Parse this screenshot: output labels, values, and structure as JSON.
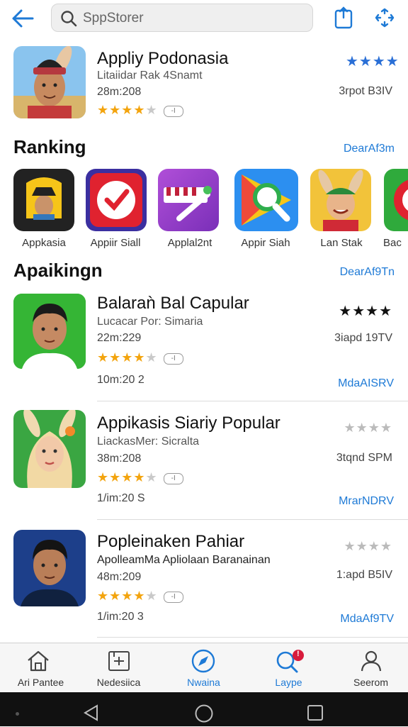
{
  "search": {
    "placeholder": "SppStorer"
  },
  "featured": {
    "title": "Appliy Podonasia",
    "subtitle": "Litaiidar Rak 4Snamt",
    "meta": "28m:208",
    "right_meta": "3rpot B3IV",
    "stars": 4.5,
    "chip": "-I",
    "star_color": "#2a6fd6"
  },
  "ranking": {
    "title": "Ranking",
    "link": "DearAf3m",
    "items": [
      {
        "label": "Appkasia",
        "icon": "portrait-hat-icon",
        "bg": "#222222"
      },
      {
        "label": "Appiir Siall",
        "icon": "red-heart-check-icon",
        "bg": "#d91c2a"
      },
      {
        "label": "Applal2nt",
        "icon": "piano-keyboard-icon",
        "bg": "#8a3fc8"
      },
      {
        "label": "Appir Siah",
        "icon": "play-search-icon",
        "bg": "#2c8ff0"
      },
      {
        "label": "Lan Stak",
        "icon": "bunny-character-icon",
        "bg": "#f2c33a"
      },
      {
        "label": "Bac",
        "icon": "red-circle-icon",
        "bg": "#2faa3c"
      }
    ]
  },
  "apps": {
    "title": "Apaikingn",
    "link": "DearAf9Tn",
    "items": [
      {
        "title": "Balaraǹ Bal Capular",
        "subtitle": "Lucacar Por: Simaria",
        "meta": "22m:229",
        "size": "10m:20 2",
        "right_meta": "3iapd 19TV",
        "link": "MdaAISRV",
        "stars": 4,
        "top_stars": "★★★★",
        "top_stars_color": "#111111",
        "chip": "-I",
        "thumb_bg": "#2fa32f"
      },
      {
        "title": "Appikasis Siariy Popular",
        "subtitle": "LiackasMer: Sicralta",
        "meta": "38m:208",
        "size": "1/im:20 S",
        "right_meta": "3tqnd SPM",
        "link": "MrarNDRV",
        "stars": 4,
        "top_stars": "★★★★",
        "top_stars_color": "#bbbbbb",
        "chip": "-I",
        "thumb_bg": "#2e9e3a"
      },
      {
        "title": "Popleinaken Pahiar",
        "subtitle": "ApolleamMa Apliolaan  Baranainan",
        "meta": "48m:209",
        "size": "1/im:20 3",
        "right_meta": "1:apd B5IV",
        "link": "MdaAf9TV",
        "stars": 4.5,
        "top_stars": "★★★★",
        "top_stars_color": "#bbbbbb",
        "chip": "-I",
        "thumb_bg": "#1d3f8a"
      }
    ]
  },
  "nav": [
    {
      "label": "Ari Pantee",
      "icon": "home-icon"
    },
    {
      "label": "Nedesiica",
      "icon": "book-icon"
    },
    {
      "label": "Nwaina",
      "icon": "compass-icon",
      "active": true
    },
    {
      "label": "Laype",
      "icon": "search-badge-icon",
      "badge": "!"
    },
    {
      "label": "Seerom",
      "icon": "profile-icon"
    }
  ],
  "colors": {
    "accent": "#1e7ad6",
    "star": "#f3a40e",
    "badge": "#d81b3c"
  }
}
